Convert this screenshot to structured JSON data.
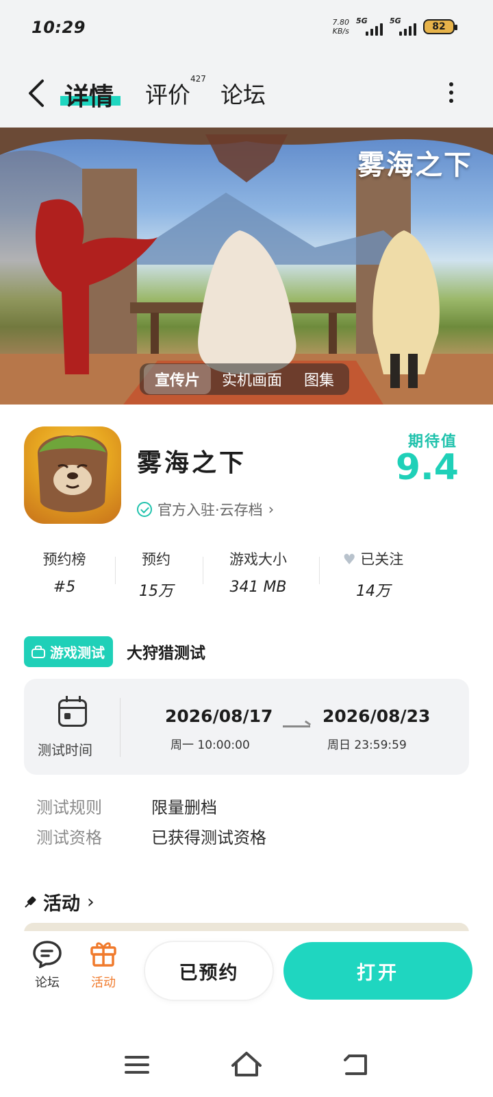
{
  "status_bar": {
    "time": "10:29",
    "net_speed": "7.80",
    "net_unit": "KB/s",
    "signal1": "5G",
    "signal2": "5G",
    "battery": "82"
  },
  "nav": {
    "tabs": [
      {
        "label": "详情"
      },
      {
        "label": "评价"
      },
      {
        "label": "论坛"
      }
    ],
    "reviews_count": "427"
  },
  "banner": {
    "logo_text": "雾海之下",
    "media_tabs": [
      "宣传片",
      "实机画面",
      "图集"
    ]
  },
  "app": {
    "name": "雾海之下",
    "official_text": "官方入驻·云存档",
    "expect_label": "期待值",
    "expect_value": "9.4"
  },
  "stats": [
    {
      "label": "预约榜",
      "value": "#5"
    },
    {
      "label": "预约",
      "value": "15万"
    },
    {
      "label": "游戏大小",
      "value": "341 MB"
    },
    {
      "label": "已关注",
      "value": "14万"
    }
  ],
  "test": {
    "badge": "游戏测试",
    "title": "大狩猎测试",
    "time_label": "测试时间",
    "start_date": "2026/08/17",
    "start_sub": "周一 10:00:00",
    "end_date": "2026/08/23",
    "end_sub": "周日 23:59:59",
    "rules_label": "测试规则",
    "rules_value": "限量删档",
    "qual_label": "测试资格",
    "qual_value": "已获得测试资格"
  },
  "activity": {
    "title": "活动"
  },
  "bottom_bar": {
    "forum": "论坛",
    "activity": "活动",
    "reserved": "已预约",
    "open": "打开"
  },
  "colors": {
    "accent": "#1fd6c0",
    "activity_orange": "#f07a2c"
  }
}
